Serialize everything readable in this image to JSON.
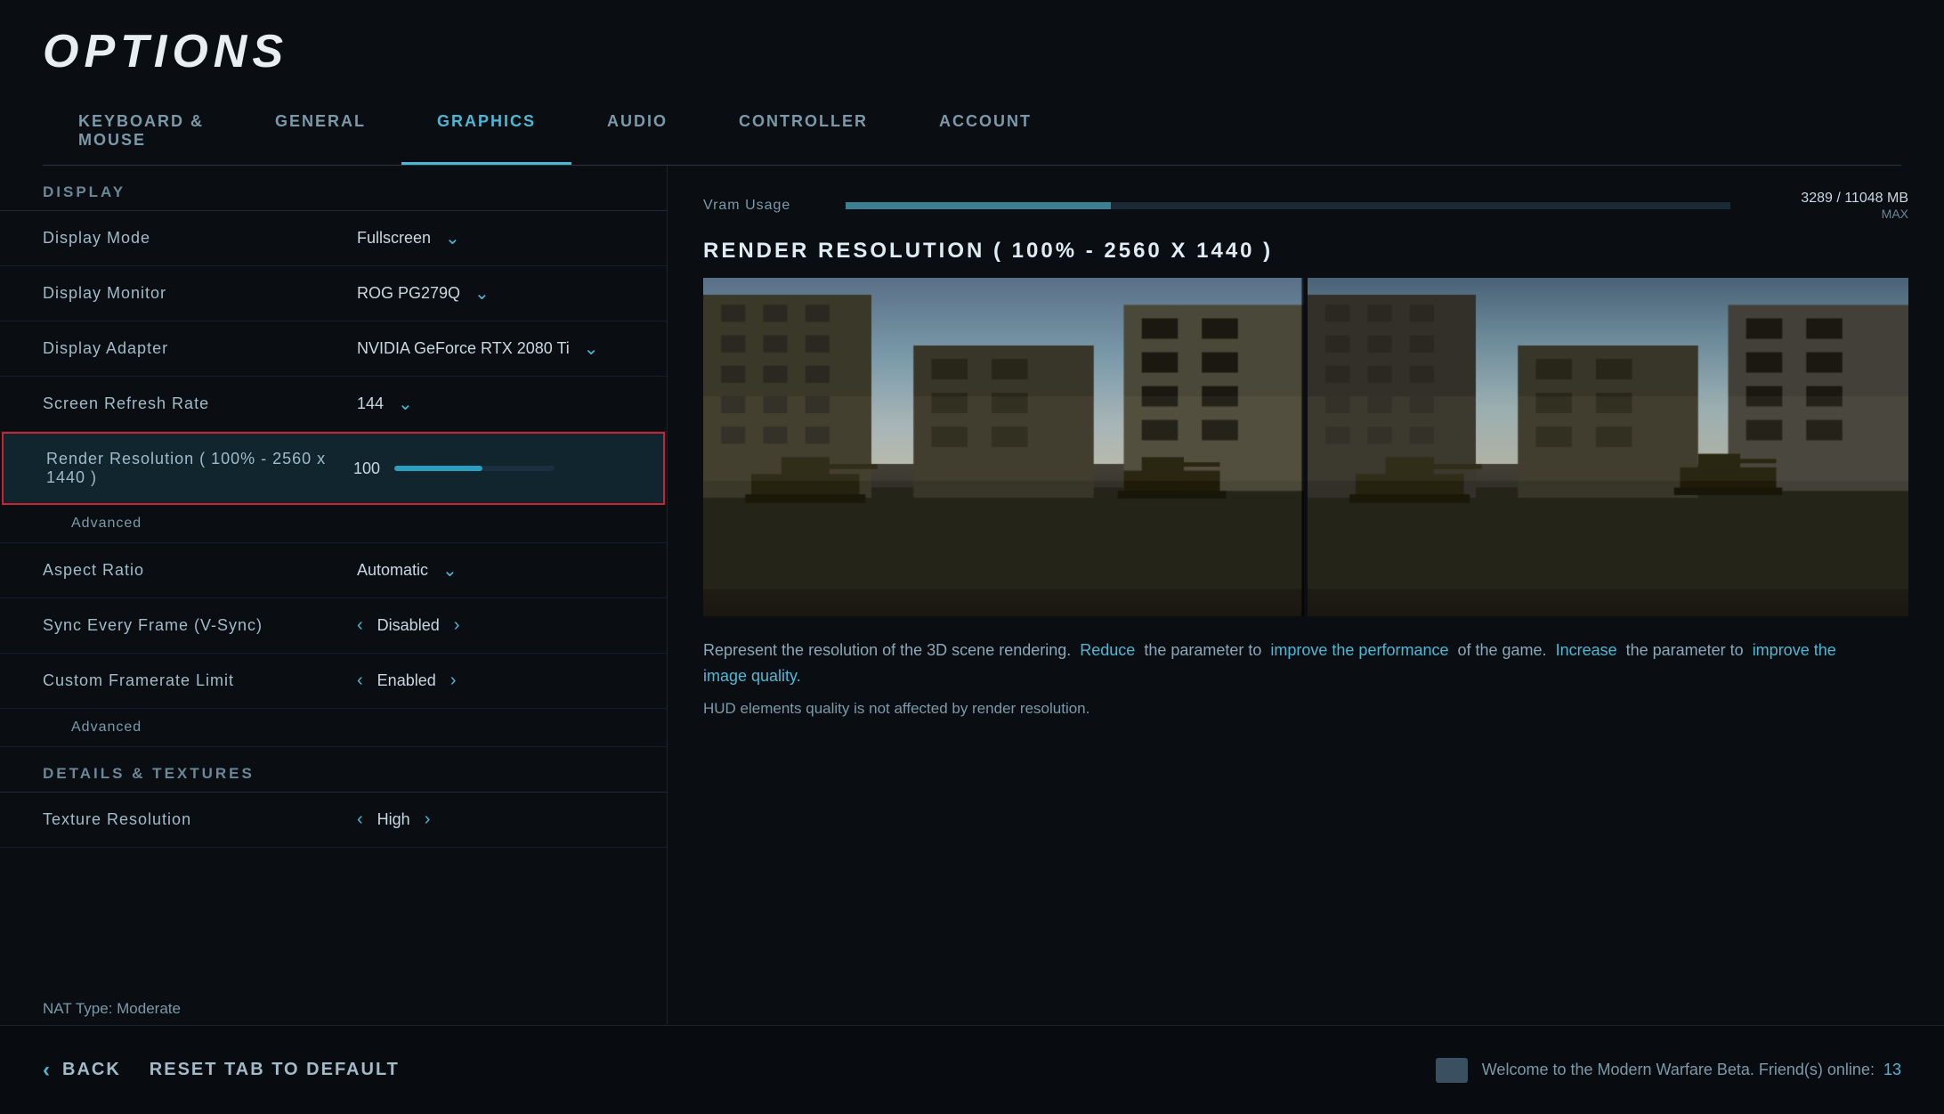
{
  "page": {
    "title": "OPTIONS"
  },
  "nav": {
    "tabs": [
      {
        "id": "keyboard-mouse",
        "label": "KEYBOARD &\nMOUSE",
        "active": false
      },
      {
        "id": "general",
        "label": "GENERAL",
        "active": false
      },
      {
        "id": "graphics",
        "label": "GRAPHICS",
        "active": true
      },
      {
        "id": "audio",
        "label": "AUDIO",
        "active": false
      },
      {
        "id": "controller",
        "label": "CONTROLLER",
        "active": false
      },
      {
        "id": "account",
        "label": "ACCOUNT",
        "active": false
      }
    ]
  },
  "vram": {
    "label": "Vram Usage",
    "used": "3289",
    "total": "11048",
    "unit": "MB",
    "max_label": "MAX",
    "fill_percent": 30
  },
  "preview": {
    "title": "RENDER RESOLUTION ( 100% - 2560 X 1440 )",
    "description_parts": [
      {
        "text": "Represent the resolution of the 3D scene rendering. ",
        "style": "normal"
      },
      {
        "text": "Reduce",
        "style": "highlight"
      },
      {
        "text": " the parameter to ",
        "style": "normal"
      },
      {
        "text": "improve the performance",
        "style": "highlight"
      },
      {
        "text": " of the game. ",
        "style": "normal"
      },
      {
        "text": "Increase",
        "style": "highlight"
      },
      {
        "text": " the parameter to ",
        "style": "normal"
      },
      {
        "text": "improve the image quality.",
        "style": "highlight"
      }
    ],
    "note": "HUD elements quality is not affected by render resolution."
  },
  "settings": {
    "display_section": "DISPLAY",
    "rows": [
      {
        "id": "display-mode",
        "label": "Display Mode",
        "value": "Fullscreen",
        "control": "dropdown"
      },
      {
        "id": "display-monitor",
        "label": "Display Monitor",
        "value": "ROG PG279Q",
        "control": "dropdown"
      },
      {
        "id": "display-adapter",
        "label": "Display Adapter",
        "value": "NVIDIA GeForce RTX 2080 Ti",
        "control": "dropdown"
      },
      {
        "id": "screen-refresh-rate",
        "label": "Screen Refresh Rate",
        "value": "144",
        "control": "dropdown"
      },
      {
        "id": "render-resolution",
        "label": "Render Resolution ( 100% - 2560 x 1440 )",
        "value": "100",
        "slider_fill": 55,
        "control": "slider",
        "highlighted": true
      }
    ],
    "advanced_label": "Advanced",
    "aspect_ratio_label": "Aspect Ratio",
    "aspect_ratio_value": "Automatic",
    "vsync_label": "Sync Every Frame (V-Sync)",
    "vsync_value": "Disabled",
    "framerate_label": "Custom Framerate Limit",
    "framerate_value": "Enabled",
    "advanced2_label": "Advanced",
    "details_section": "DETAILS & TEXTURES",
    "texture_label": "Texture Resolution",
    "texture_value": "High"
  },
  "bottom": {
    "back_label": "Back",
    "reset_label": "Reset tab to Default",
    "message": "Welcome to the Modern Warfare Beta. Friend(s) online:",
    "friends_count": "13",
    "nat_label": "NAT Type: Moderate"
  }
}
